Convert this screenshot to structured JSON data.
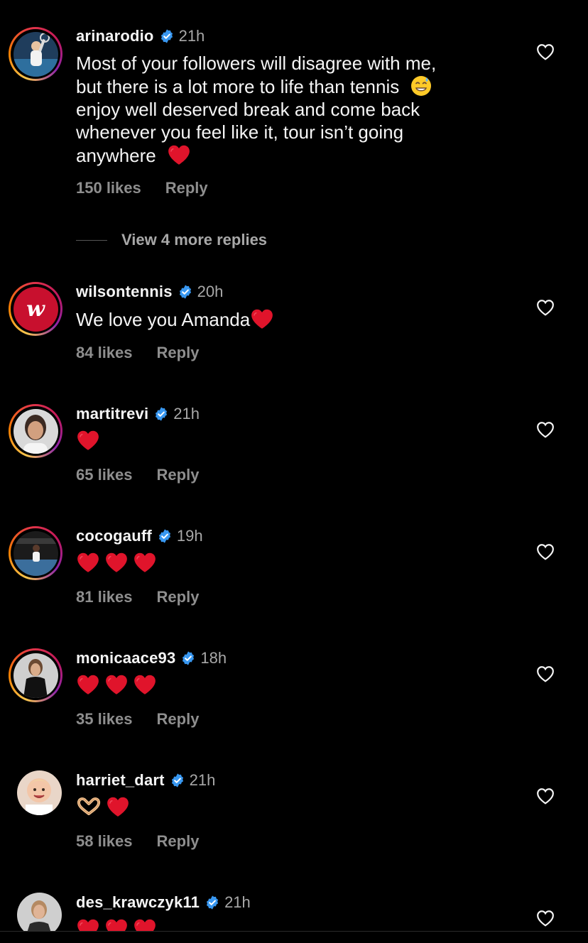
{
  "colors": {
    "background": "#000000",
    "text_primary": "#f5f5f5",
    "text_secondary": "#a8a8a8",
    "verified_blue": "#3897f0",
    "heart_red": "#e0142b"
  },
  "view_more_replies": "View 4 more replies",
  "comments": [
    {
      "username": "arinarodio",
      "verified": true,
      "time": "21h",
      "text_lines": [
        "Most of your followers will disagree with me,",
        "but there is a lot more to life than tennis",
        "enjoy well deserved break and come back",
        "whenever you feel like it, tour isn’t going",
        "anywhere"
      ],
      "emojis": [
        "grinning-sweat-emoji",
        "red-heart-emoji"
      ],
      "likes": "150 likes",
      "reply": "Reply",
      "avatar_icon": "tennis-player-avatar"
    },
    {
      "username": "wilsontennis",
      "verified": true,
      "time": "20h",
      "text": "We love you Amanda",
      "emojis": [
        "red-heart-emoji"
      ],
      "likes": "84 likes",
      "reply": "Reply",
      "avatar_letter": "w",
      "avatar_icon": "wilson-logo"
    },
    {
      "username": "martitrevi",
      "verified": true,
      "time": "21h",
      "emojis": [
        "red-heart-emoji"
      ],
      "likes": "65 likes",
      "reply": "Reply",
      "avatar_icon": "portrait-avatar"
    },
    {
      "username": "cocogauff",
      "verified": true,
      "time": "19h",
      "emojis": [
        "red-heart-emoji",
        "red-heart-emoji",
        "red-heart-emoji"
      ],
      "likes": "81 likes",
      "reply": "Reply",
      "avatar_icon": "tennis-court-avatar"
    },
    {
      "username": "monicaace93",
      "verified": true,
      "time": "18h",
      "emojis": [
        "red-heart-emoji",
        "red-heart-emoji",
        "red-heart-emoji"
      ],
      "likes": "35 likes",
      "reply": "Reply",
      "avatar_icon": "portrait-avatar"
    },
    {
      "username": "harriet_dart",
      "verified": true,
      "time": "21h",
      "emojis": [
        "heart-hands-emoji",
        "red-heart-emoji"
      ],
      "likes": "58 likes",
      "reply": "Reply",
      "avatar_icon": "baby-photo-avatar"
    },
    {
      "username": "des_krawczyk11",
      "verified": true,
      "time": "21h",
      "emojis": [
        "red-heart-emoji",
        "red-heart-emoji",
        "red-heart-emoji"
      ],
      "avatar_icon": "portrait-avatar"
    }
  ]
}
